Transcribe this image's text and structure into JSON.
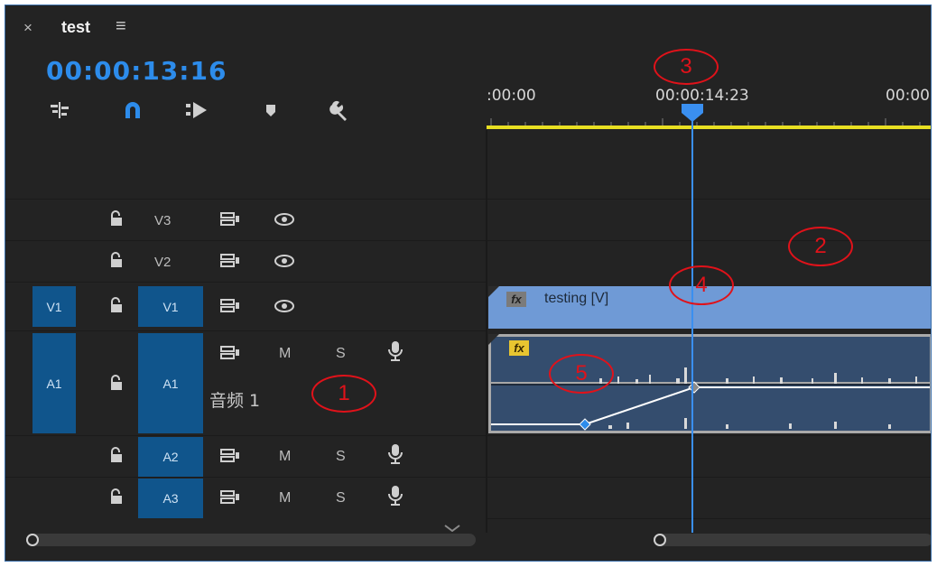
{
  "header": {
    "close_glyph": "×",
    "title": "test",
    "menu_glyph": "≡",
    "timecode": "00:00:13:16",
    "tools": [
      "insert-tool-icon",
      "snap-magnet-icon",
      "linked-selection-icon",
      "add-marker-icon",
      "wrench-settings-icon"
    ]
  },
  "ruler": {
    "labels": [
      ":00:00",
      "00:00:14:23",
      "00:00"
    ],
    "work_area_color": "#e8df22"
  },
  "tracks": {
    "video": [
      {
        "source": "",
        "name": "V3"
      },
      {
        "source": "",
        "name": "V2"
      },
      {
        "source": "V1",
        "name": "V1"
      }
    ],
    "audio": [
      {
        "source": "A1",
        "name": "A1",
        "mute": "M",
        "solo": "S",
        "track_name": "音频 1"
      },
      {
        "source": "",
        "name": "A2",
        "mute": "M",
        "solo": "S"
      },
      {
        "source": "",
        "name": "A3",
        "mute": "M",
        "solo": "S"
      }
    ]
  },
  "clips": {
    "video_clip": {
      "fx": "fx",
      "label": "testing [V]",
      "color": "#6f9ad6"
    },
    "audio_clip": {
      "fx": "fx",
      "color": "#344d6e"
    }
  },
  "annotations": [
    "1",
    "2",
    "3",
    "4",
    "5"
  ],
  "colors": {
    "accent": "#2d8ceb",
    "track_target": "#10558c",
    "playhead": "#3a8ff0",
    "annotation": "#e0121a"
  }
}
